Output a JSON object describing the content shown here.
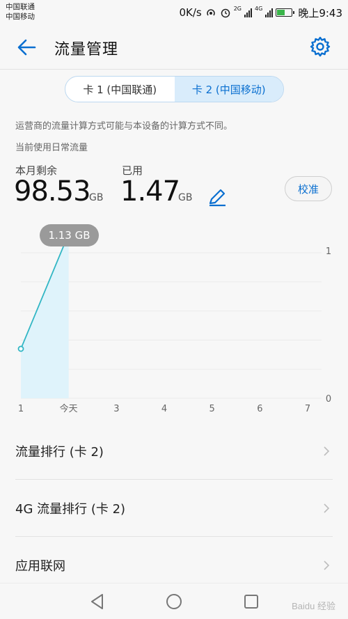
{
  "status_bar": {
    "carrier1": "中国联通",
    "carrier2": "中国移动",
    "speed": "0K/s",
    "net1": "2G",
    "net2": "4G",
    "time": "晚上9:43"
  },
  "app_bar": {
    "title": "流量管理",
    "back_icon": "arrow-left-icon",
    "settings_icon": "gear-icon"
  },
  "sim_tabs": [
    {
      "label": "卡 1 (中国联通)",
      "selected": false
    },
    {
      "label": "卡 2 (中国移动)",
      "selected": true
    }
  ],
  "notice": "运营商的流量计算方式可能与本设备的计算方式不同。",
  "usage_caption": "当前使用日常流量",
  "usage": {
    "remaining_label": "本月剩余",
    "remaining_value": "98.53",
    "remaining_unit": "GB",
    "used_label": "已用",
    "used_value": "1.47",
    "used_unit": "GB",
    "calibrate_label": "校准",
    "edit_icon": "pencil-icon"
  },
  "chart_data": {
    "type": "area",
    "x": [
      "1",
      "今天",
      "3",
      "4",
      "5",
      "6",
      "7"
    ],
    "values": [
      0.34,
      1.13
    ],
    "tooltip": "1.13 GB",
    "ylim": [
      0,
      1
    ],
    "y_tick_labels": [
      "1",
      "0"
    ],
    "grid": true,
    "accent": "#31b6c4"
  },
  "menu": [
    {
      "label": "流量排行 (卡 2)"
    },
    {
      "label": "4G 流量排行 (卡 2)"
    },
    {
      "label": "应用联网"
    }
  ],
  "nav_bar": {
    "back": "triangle-back-icon",
    "home": "circle-home-icon",
    "recents": "square-recents-icon"
  },
  "watermark": "Baidu 经验",
  "colors": {
    "accent": "#0a6fd0",
    "chart_line": "#31b6c4",
    "tooltip_bg": "#9a9a9a"
  }
}
